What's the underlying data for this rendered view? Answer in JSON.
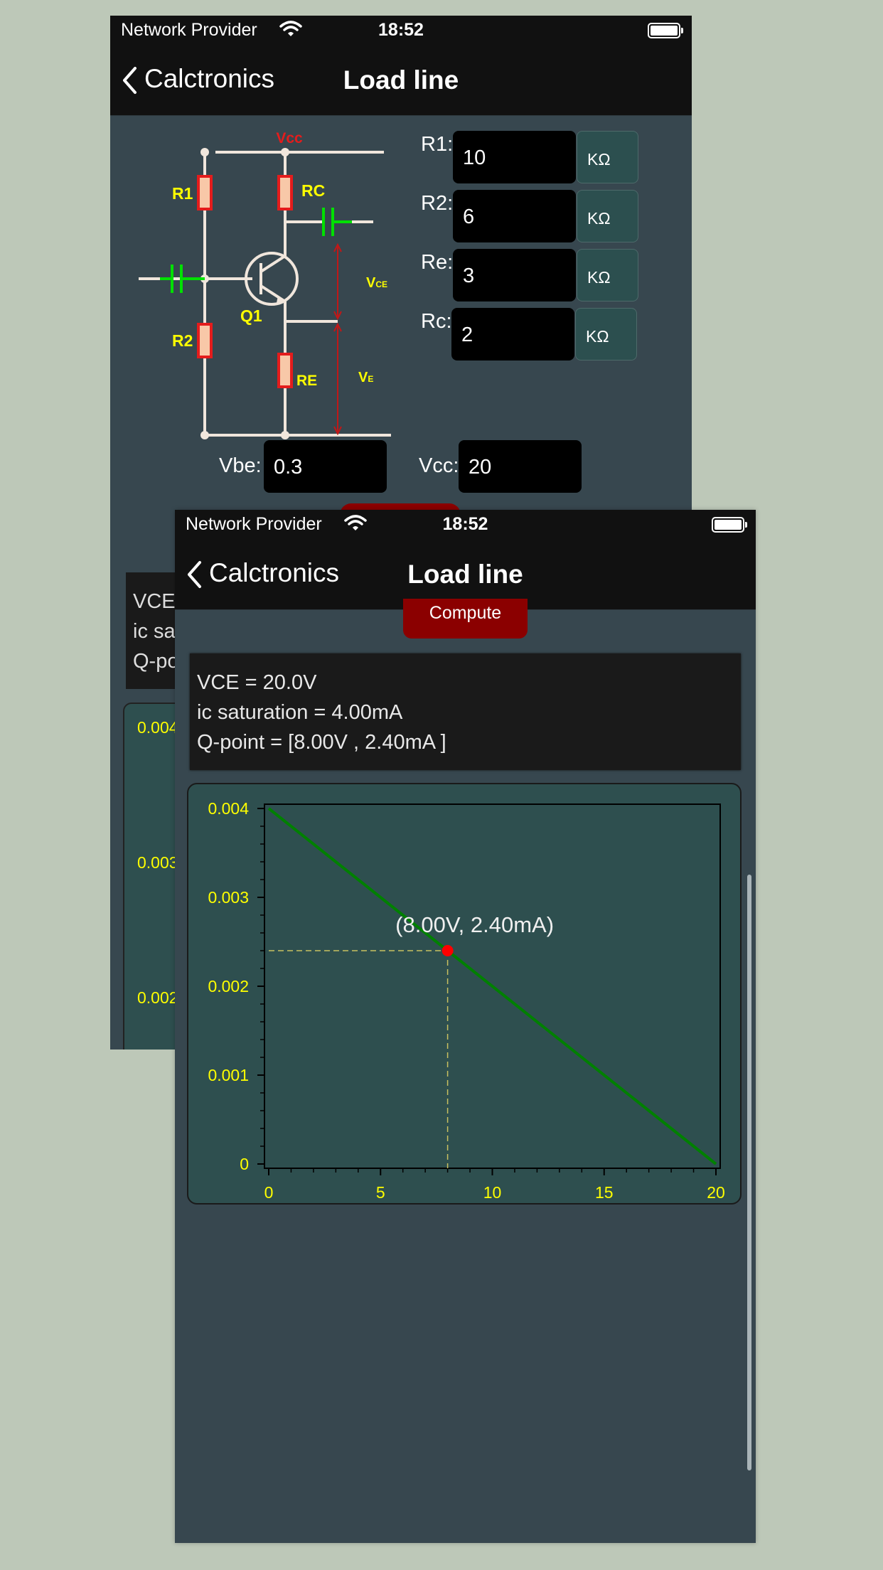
{
  "status": {
    "carrier": "Network Provider",
    "time": "18:52"
  },
  "nav": {
    "back_label": "Calctronics",
    "title": "Load line"
  },
  "circuit_labels": {
    "vcc": "Vcc",
    "r1": "R1",
    "r2": "R2",
    "rc": "RC",
    "re": "RE",
    "q1": "Q1",
    "vce": "V",
    "vce_sub": "CE",
    "ve": "V",
    "ve_sub": "E"
  },
  "inputs": {
    "r1": {
      "label": "R1:",
      "value": "10",
      "unit": "KΩ"
    },
    "r2": {
      "label": "R2:",
      "value": "6",
      "unit": "KΩ"
    },
    "re": {
      "label": "Re:",
      "value": "3",
      "unit": "KΩ"
    },
    "rc": {
      "label": "Rc:",
      "value": "2",
      "unit": "KΩ"
    },
    "vbe": {
      "label": "Vbe:",
      "value": "0.3"
    },
    "vcc": {
      "label": "Vcc:",
      "value": "20"
    }
  },
  "back_peek": {
    "result_lines": [
      "VCE",
      "ic sa",
      "Q-po"
    ],
    "tick_labels": [
      "0.004",
      "0.003",
      "0.002"
    ]
  },
  "compute_label": "Compute",
  "results": {
    "vce": "VCE = 20.0V",
    "ic_sat": "ic saturation = 4.00mA",
    "qpoint": "Q-point = [8.00V , 2.40mA ]"
  },
  "chart_data": {
    "type": "line",
    "title": "",
    "xlabel": "",
    "ylabel": "",
    "xlim": [
      0,
      20
    ],
    "ylim": [
      0,
      0.004
    ],
    "x_ticks": [
      0,
      5,
      10,
      15,
      20
    ],
    "x_tick_labels": [
      "0",
      "5",
      "10",
      "15",
      "20"
    ],
    "y_ticks": [
      0,
      0.001,
      0.002,
      0.003,
      0.004
    ],
    "y_tick_labels": [
      "0",
      "0.001",
      "0.002",
      "0.003",
      "0.004"
    ],
    "series": [
      {
        "x": [
          0,
          20
        ],
        "y": [
          0.004,
          0
        ],
        "color": "#008000"
      }
    ],
    "q_point": {
      "x": 8,
      "y": 0.0024,
      "label": "(8.00V, 2.40mA)",
      "color": "#ff0000"
    },
    "grid": false
  },
  "colors": {
    "accent_red": "#8b0000",
    "tick_yellow": "#ffff00",
    "line_green": "#008000",
    "panel": "#2e4f4f",
    "background": "#37474f"
  }
}
